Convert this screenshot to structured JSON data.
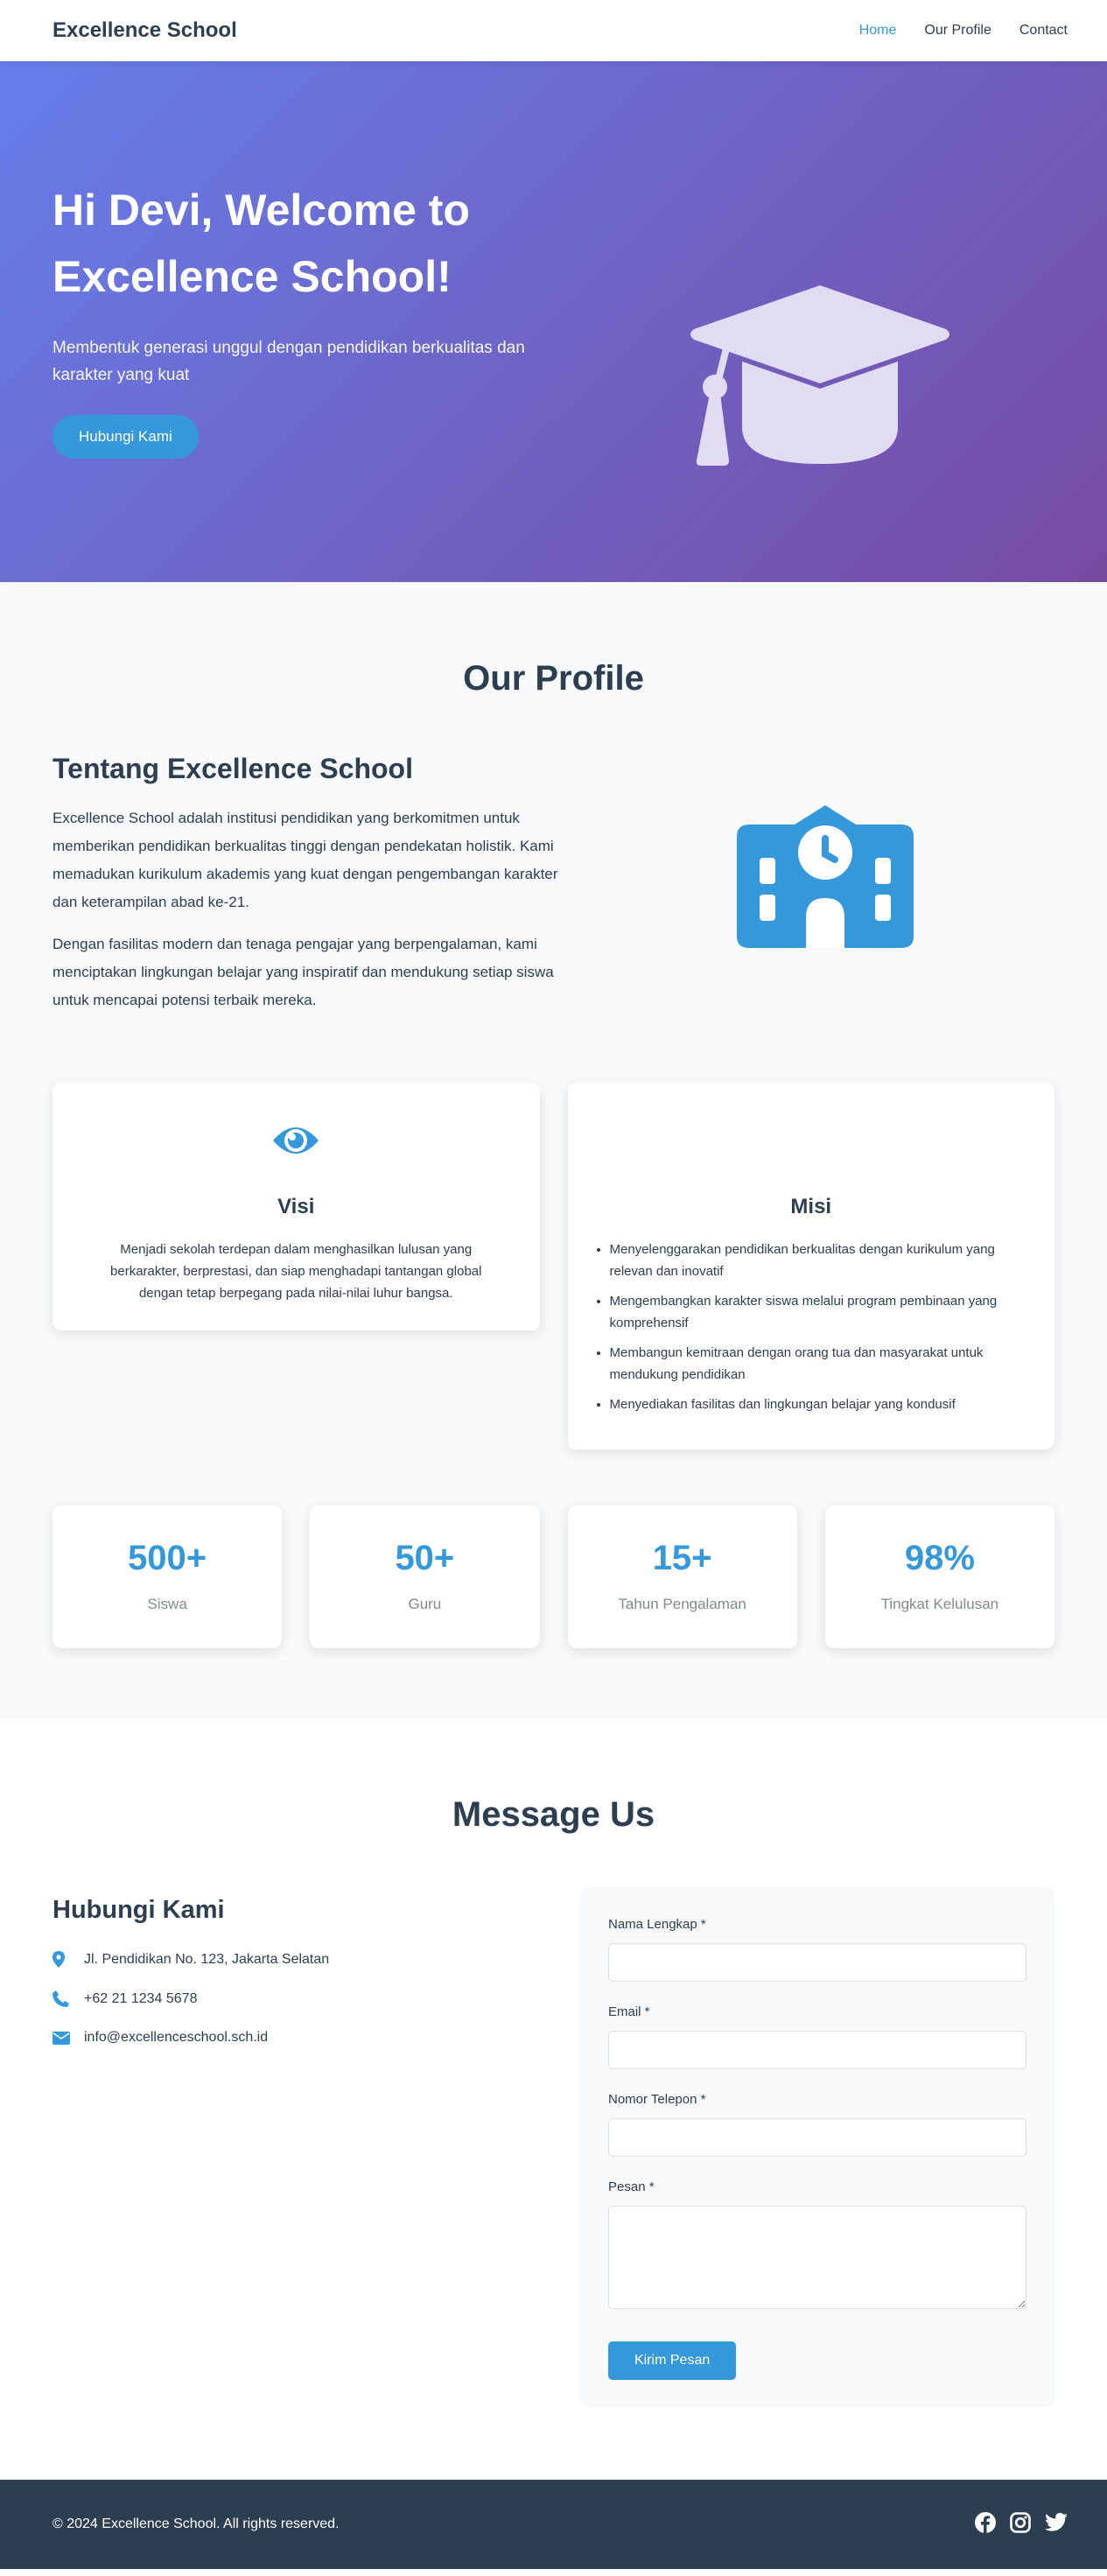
{
  "nav": {
    "brand": "Excellence School",
    "links": [
      {
        "label": "Home",
        "active": true
      },
      {
        "label": "Our Profile",
        "active": false
      },
      {
        "label": "Contact",
        "active": false
      }
    ]
  },
  "hero": {
    "title_line1": "Hi Devi, Welcome to",
    "title_line2": "Excellence School!",
    "subtitle": "Membentuk generasi unggul dengan pendidikan berkualitas dan karakter yang kuat",
    "cta_label": "Hubungi Kami",
    "icon": "graduation-cap-icon"
  },
  "profile": {
    "section_title": "Our Profile",
    "about_title": "Tentang Excellence School",
    "about_p1": "Excellence School adalah institusi pendidikan yang berkomitmen untuk memberikan pendidikan berkualitas tinggi dengan pendekatan holistik. Kami memadukan kurikulum akademis yang kuat dengan pengembangan karakter dan keterampilan abad ke-21.",
    "about_p2": "Dengan fasilitas modern dan tenaga pengajar yang berpengalaman, kami menciptakan lingkungan belajar yang inspiratif dan mendukung setiap siswa untuk mencapai potensi terbaik mereka.",
    "about_icon": "school-icon",
    "visi": {
      "icon": "eye-icon",
      "title": "Visi",
      "text": "Menjadi sekolah terdepan dalam menghasilkan lulusan yang berkarakter, berprestasi, dan siap menghadapi tantangan global dengan tetap berpegang pada nilai-nilai luhur bangsa."
    },
    "misi": {
      "title": "Misi",
      "items": [
        "Menyelenggarakan pendidikan berkualitas dengan kurikulum yang relevan dan inovatif",
        "Mengembangkan karakter siswa melalui program pembinaan yang komprehensif",
        "Membangun kemitraan dengan orang tua dan masyarakat untuk mendukung pendidikan",
        "Menyediakan fasilitas dan lingkungan belajar yang kondusif"
      ]
    },
    "stats": [
      {
        "number": "500+",
        "label": "Siswa"
      },
      {
        "number": "50+",
        "label": "Guru"
      },
      {
        "number": "15+",
        "label": "Tahun Pengalaman"
      },
      {
        "number": "98%",
        "label": "Tingkat Kelulusan"
      }
    ]
  },
  "message": {
    "section_title": "Message Us",
    "contact_title": "Hubungi Kami",
    "address": "Jl. Pendidikan No. 123, Jakarta Selatan",
    "phone": "+62 21 1234 5678",
    "email": "info@excellenceschool.sch.id",
    "form": {
      "name_label": "Nama Lengkap *",
      "email_label": "Email *",
      "phone_label": "Nomor Telepon *",
      "message_label": "Pesan *",
      "submit_label": "Kirim Pesan"
    }
  },
  "footer": {
    "copyright": "© 2024 Excellence School. All rights reserved.",
    "socials": [
      "facebook-icon",
      "instagram-icon",
      "twitter-icon"
    ]
  },
  "colors": {
    "primary": "#3498db",
    "dark": "#2c3e50",
    "hero_start": "#667eea",
    "hero_end": "#764ba2"
  }
}
